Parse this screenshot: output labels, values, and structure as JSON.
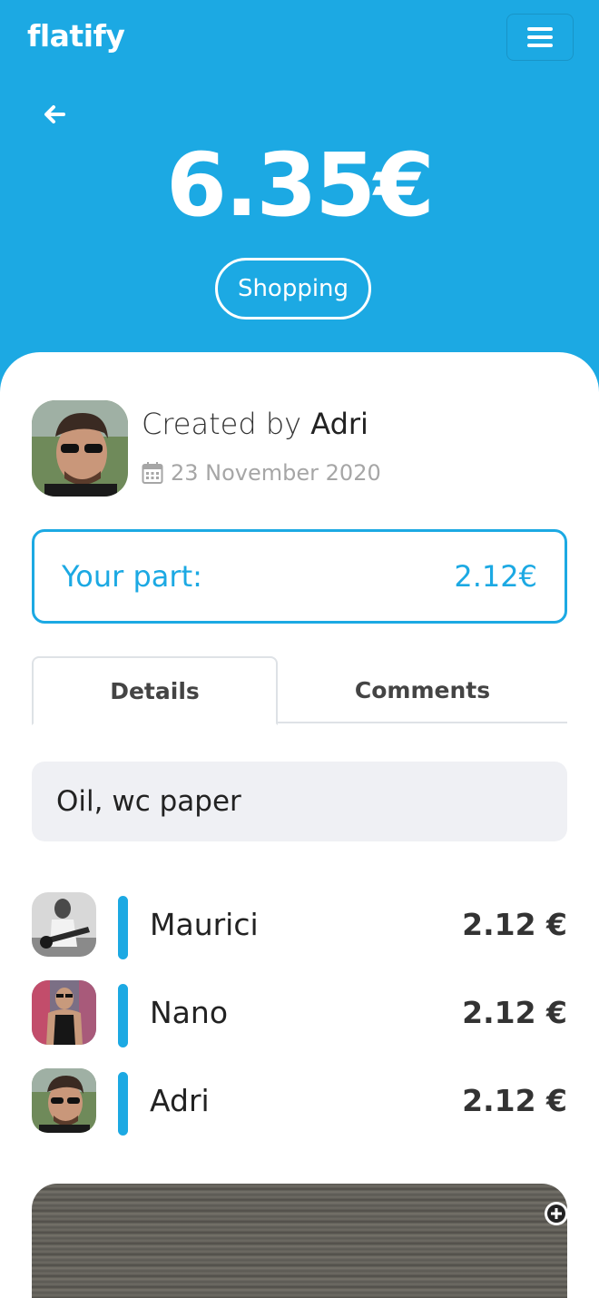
{
  "app": {
    "logo": "flatify"
  },
  "expense": {
    "amount": "6.35€",
    "category": "Shopping",
    "created_prefix": "Created by",
    "creator": "Adri",
    "date": "23 November 2020",
    "your_part_label": "Your part:",
    "your_part_value": "2.12€",
    "description": "Oil, wc paper"
  },
  "tabs": {
    "details": "Details",
    "comments": "Comments"
  },
  "members": [
    {
      "name": "Maurici",
      "amount": "2.12 €"
    },
    {
      "name": "Nano",
      "amount": "2.12 €"
    },
    {
      "name": "Adri",
      "amount": "2.12 €"
    }
  ],
  "icons": {
    "menu": "hamburger-icon",
    "back": "arrow-left-icon",
    "date": "calendar-icon",
    "zoom": "zoom-in-icon"
  },
  "colors": {
    "accent": "#1ca9e3",
    "surface": "#eff0f4"
  }
}
